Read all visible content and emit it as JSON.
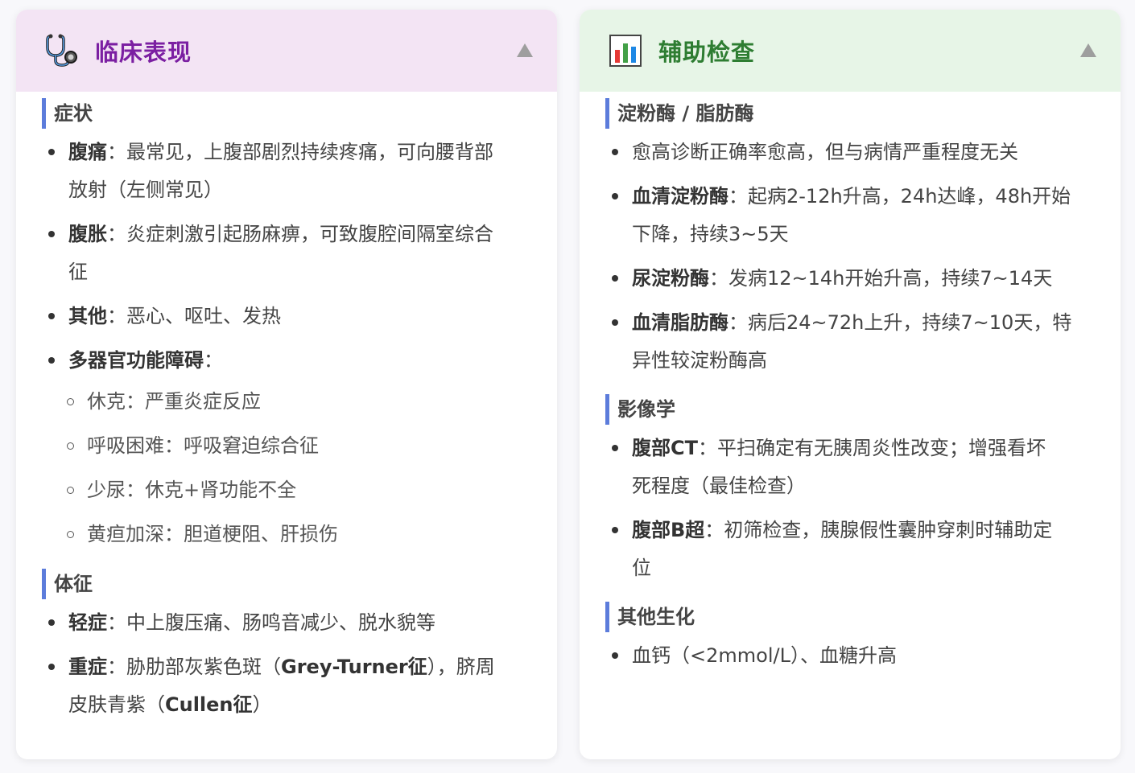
{
  "left_card": {
    "icon": "stethoscope-icon",
    "title": "临床表现",
    "sections": [
      {
        "title": "症状",
        "items": [
          {
            "label": "腹痛",
            "sep": "：",
            "text": "最常见，上腹部剧烈持续疼痛，可向腰背部",
            "text2": "放射（左侧常见）"
          },
          {
            "label": "腹胀",
            "sep": "：",
            "text": "炎症刺激引起肠麻痹，可致腹腔间隔室综合",
            "text2": "征"
          },
          {
            "label": "其他",
            "sep": "：",
            "text": "恶心、呕吐、发热"
          },
          {
            "label": "多器官功能障碍",
            "sep": "："
          }
        ],
        "subitems": [
          "休克：严重炎症反应",
          "呼吸困难：呼吸窘迫综合征",
          "少尿：休克+肾功能不全",
          "黄疸加深：胆道梗阻、肝损伤"
        ]
      },
      {
        "title": "体征",
        "items": [
          {
            "label": "轻症",
            "sep": "：",
            "text": "中上腹压痛、肠鸣音减少、脱水貌等"
          },
          {
            "label": "重症",
            "sep": "：",
            "text_a": "胁肋部灰紫色斑（",
            "bold_a": "Grey-Turner征",
            "text_b": "），脐周",
            "text_c": "皮肤青紫（",
            "bold_b": "Cullen征",
            "text_d": "）"
          }
        ]
      }
    ]
  },
  "right_card": {
    "icon": "bar-chart-icon",
    "title": "辅助检查",
    "sections": [
      {
        "title": "淀粉酶 / 脂肪酶",
        "items": [
          {
            "text": "愈高诊断正确率愈高，但与病情严重程度无关"
          },
          {
            "label": "血清淀粉酶",
            "sep": "：",
            "text": "起病2-12h升高，24h达峰，48h开始",
            "text2": "下降，持续3~5天"
          },
          {
            "label": "尿淀粉酶",
            "sep": "：",
            "text": "发病12~14h开始升高，持续7~14天"
          },
          {
            "label": "血清脂肪酶",
            "sep": "：",
            "text": "病后24~72h上升，持续7~10天，特",
            "text2": "异性较淀粉酶高"
          }
        ]
      },
      {
        "title": "影像学",
        "items": [
          {
            "label": "腹部CT",
            "sep": "：",
            "text": "平扫确定有无胰周炎性改变；增强看坏",
            "text2": "死程度（最佳检查）"
          },
          {
            "label": "腹部B超",
            "sep": "：",
            "text": "初筛检查，胰腺假性囊肿穿刺时辅助定",
            "text2": "位"
          }
        ]
      },
      {
        "title": "其他生化",
        "items": [
          {
            "text": "血钙（<2mmol/L）、血糖升高"
          }
        ]
      }
    ]
  },
  "colors": {
    "left_header_bg": "#f3e4f4",
    "left_title": "#7b1fa2",
    "right_header_bg": "#e7f5e7",
    "right_title": "#2e7d32",
    "section_bar": "#5c7cdb"
  }
}
